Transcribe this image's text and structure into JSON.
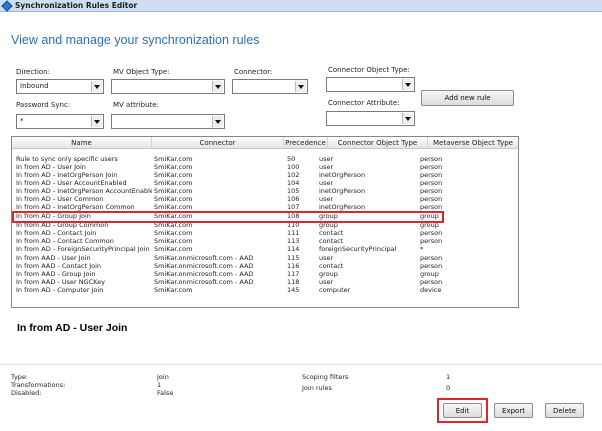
{
  "window": {
    "title": "Synchronization Rules Editor"
  },
  "heading": "View and manage your synchronization rules",
  "filters": {
    "direction": {
      "label": "Direction:",
      "value": "Inbound"
    },
    "mv_object_type": {
      "label": "MV Object Type:",
      "value": ""
    },
    "connector": {
      "label": "Connector:",
      "value": ""
    },
    "connector_object_type": {
      "label": "Connector Object Type:",
      "value": ""
    },
    "password_sync": {
      "label": "Password Sync:",
      "value": "*"
    },
    "mv_attribute": {
      "label": "MV attribute:",
      "value": ""
    },
    "connector_attribute": {
      "label": "Connector Attribute:",
      "value": ""
    },
    "add_new_rule": "Add new rule"
  },
  "grid": {
    "columns": [
      "Name",
      "Connector",
      "Precedence",
      "Connector Object Type",
      "Metaverse Object Type"
    ],
    "rows": [
      [
        "Rule to sync only specific users",
        "SmiKar.com",
        "50",
        "user",
        "person"
      ],
      [
        "In from AD - User Join",
        "SmiKar.com",
        "100",
        "user",
        "person"
      ],
      [
        "In from AD - InetOrgPerson Join",
        "SmiKar.com",
        "102",
        "inetOrgPerson",
        "person"
      ],
      [
        "In from AD - User AccountEnabled",
        "SmiKar.com",
        "104",
        "user",
        "person"
      ],
      [
        "In from AD - InetOrgPerson AccountEnabled",
        "SmiKar.com",
        "105",
        "inetOrgPerson",
        "person"
      ],
      [
        "In from AD - User Common",
        "SmiKar.com",
        "106",
        "user",
        "person"
      ],
      [
        "In from AD - InetOrgPerson Common",
        "SmiKar.com",
        "107",
        "inetOrgPerson",
        "person"
      ],
      [
        "In from AD - Group Join",
        "SmiKar.com",
        "108",
        "group",
        "group"
      ],
      [
        "In from AD - Group Common",
        "SmiKar.com",
        "110",
        "group",
        "group"
      ],
      [
        "In from AD - Contact Join",
        "SmiKar.com",
        "111",
        "contact",
        "person"
      ],
      [
        "In from AD - Contact Common",
        "SmiKar.com",
        "113",
        "contact",
        "person"
      ],
      [
        "In from AD - ForeignSecurityPrincipal Join Us",
        "SmiKar.com",
        "114",
        "foreignSecurityPrincipal",
        "*"
      ],
      [
        "In from AAD - User Join",
        "SmiKar.onmicrosoft.com - AAD",
        "115",
        "user",
        "person"
      ],
      [
        "In from AAD - Contact Join",
        "SmiKar.onmicrosoft.com - AAD",
        "116",
        "contact",
        "person"
      ],
      [
        "In from AAD - Group Join",
        "SmiKar.onmicrosoft.com - AAD",
        "117",
        "group",
        "group"
      ],
      [
        "In from AAD - User NGCKey",
        "SmiKar.onmicrosoft.com - AAD",
        "118",
        "user",
        "person"
      ],
      [
        "In from AD - Computer Join",
        "SmiKar.com",
        "145",
        "computer",
        "device"
      ]
    ],
    "highlighted_row": 7
  },
  "details": {
    "title": "In from AD - User Join",
    "type_label": "Type:",
    "type_value": "Join",
    "transformations_label": "Transformations:",
    "transformations_value": "1",
    "disabled_label": "Disabled:",
    "disabled_value": "False",
    "scoping_label": "Scoping filters",
    "scoping_value": "1",
    "join_label": "Join rules",
    "join_value": "0"
  },
  "buttons": {
    "edit": "Edit",
    "export": "Export",
    "delete": "Delete"
  },
  "colors": {
    "highlight": "#e0252b",
    "heading": "#2f6fae",
    "titlebar": "#cfdff2"
  }
}
